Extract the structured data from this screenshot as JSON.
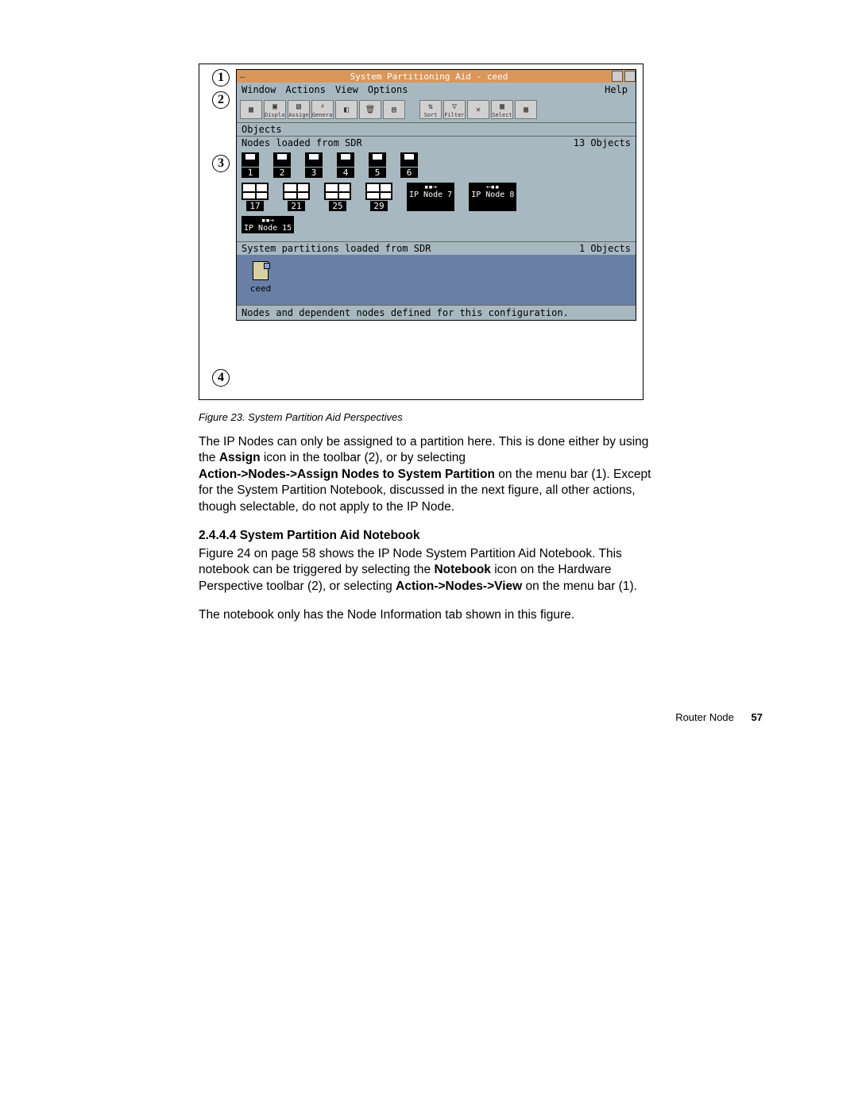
{
  "callouts": [
    "1",
    "2",
    "3",
    "4"
  ],
  "window": {
    "title": "System Partitioning Aid - ceed",
    "menubar": {
      "items": [
        "Window",
        "Actions",
        "View",
        "Options"
      ],
      "help": "Help"
    },
    "toolbar": [
      {
        "name": "notebook",
        "label": ""
      },
      {
        "name": "display",
        "label": "Display"
      },
      {
        "name": "assign",
        "label": "Assign"
      },
      {
        "name": "generate",
        "label": "Generate"
      },
      {
        "name": "activate",
        "label": ""
      },
      {
        "name": "spacer1",
        "label": ""
      },
      {
        "name": "spacer2",
        "label": ""
      },
      {
        "name": "sort",
        "label": "Sort"
      },
      {
        "name": "filter",
        "label": "Filter"
      },
      {
        "name": "remove-filter",
        "label": "Remove Filter"
      },
      {
        "name": "select",
        "label": "Select"
      },
      {
        "name": "spacer3",
        "label": ""
      }
    ],
    "objects_label": "Objects",
    "nodes_header_left": "Nodes    loaded from SDR",
    "nodes_header_right": "13 Objects",
    "nodes_row1": [
      "1",
      "2",
      "3",
      "4",
      "5",
      "6"
    ],
    "nodes_row2_wide": [
      "17",
      "21",
      "25",
      "29"
    ],
    "ip_nodes_row2": [
      "IP Node 7",
      "IP Node 8"
    ],
    "ip_nodes_row3": [
      "IP Node 15"
    ],
    "partitions_header_left": "System partitions   loaded from SDR",
    "partitions_header_right": "1 Objects",
    "partition_item": "ceed",
    "statusbar": "Nodes and dependent nodes defined for this configuration."
  },
  "caption": "Figure 23.  System Partition Aid Perspectives",
  "para1_a": "The IP Nodes can only be assigned to a partition here. This is done either by using the ",
  "para1_b_bold": "Assign",
  "para1_c": " icon in the toolbar (2), or by selecting",
  "para2_a_bold": "Action->Nodes->Assign Nodes to System Partition",
  "para2_b": " on the menu bar (1). Except for the System Partition Notebook, discussed in the next figure, all other actions, though selectable, do not apply to the IP Node.",
  "heading": "2.4.4.4  System Partition Aid Notebook",
  "para3_a": "Figure 24 on page 58 shows the IP Node System Partition Aid Notebook. This notebook can be triggered by selecting the ",
  "para3_b_bold": "Notebook",
  "para3_c": " icon on the Hardware Perspective toolbar (2), or selecting ",
  "para3_d_bold": "Action->Nodes->View",
  "para3_e": " on the menu bar (1).",
  "para4": "The notebook only has the Node Information tab shown in this figure.",
  "footer_label": "Router Node",
  "footer_page": "57"
}
